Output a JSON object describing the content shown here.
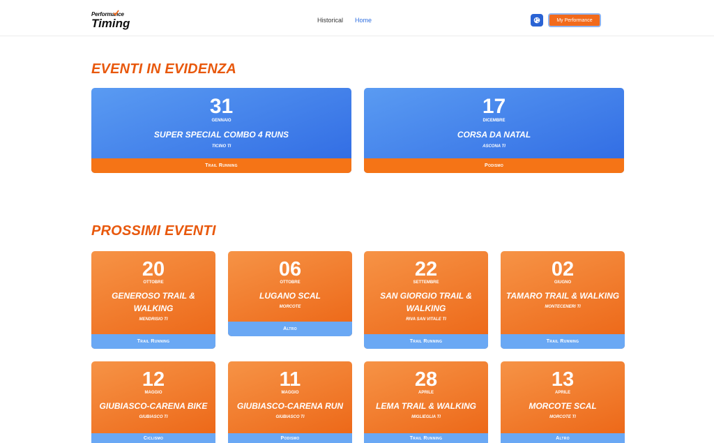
{
  "header": {
    "logo_line1": "Performance",
    "logo_line2": "Timing",
    "nav": [
      {
        "label": "Historical"
      },
      {
        "label": "Home"
      }
    ],
    "language_icon": "globe-icon",
    "my_performance_label": "My Performance"
  },
  "colors": {
    "accent_orange": "#e8580c",
    "blue": "#2f6ae3",
    "light_blue": "#6aa8f4"
  },
  "featured": {
    "title": "EVENTI IN EVIDENZA",
    "events": [
      {
        "day": "31",
        "month": "Gennaio",
        "name": "Super Special Combo 4 Runs",
        "location": "Ticino TI",
        "category": "Trail Running"
      },
      {
        "day": "17",
        "month": "Dicembre",
        "name": "Corsa da Natal",
        "location": "Ascona TI",
        "category": "Podismo"
      }
    ]
  },
  "upcoming": {
    "title": "PROSSIMI EVENTI",
    "events": [
      {
        "day": "20",
        "month": "Ottobre",
        "name": "Generoso Trail & Walking",
        "location": "Mendrisio TI",
        "category": "Trail Running"
      },
      {
        "day": "06",
        "month": "Ottobre",
        "name": "Lugano Scal",
        "location": "Morcote",
        "category": "Altro"
      },
      {
        "day": "22",
        "month": "Settembre",
        "name": "San Giorgio Trail & Walking",
        "location": "Riva San Vitale TI",
        "category": "Trail Running"
      },
      {
        "day": "02",
        "month": "Giugno",
        "name": "Tamaro Trail & Walking",
        "location": "Monteceneri TI",
        "category": "Trail Running"
      },
      {
        "day": "12",
        "month": "Maggio",
        "name": "Giubiasco-Carena Bike",
        "location": "Giubiasco TI",
        "category": "Ciclismo"
      },
      {
        "day": "11",
        "month": "Maggio",
        "name": "Giubiasco-Carena Run",
        "location": "Giubiasco TI",
        "category": "Podismo"
      },
      {
        "day": "28",
        "month": "Aprile",
        "name": "Lema Trail & Walking",
        "location": "Miglieglia TI",
        "category": "Trail Running"
      },
      {
        "day": "13",
        "month": "Aprile",
        "name": "Morcote Scal",
        "location": "Morcote TI",
        "category": "Altro"
      }
    ]
  }
}
